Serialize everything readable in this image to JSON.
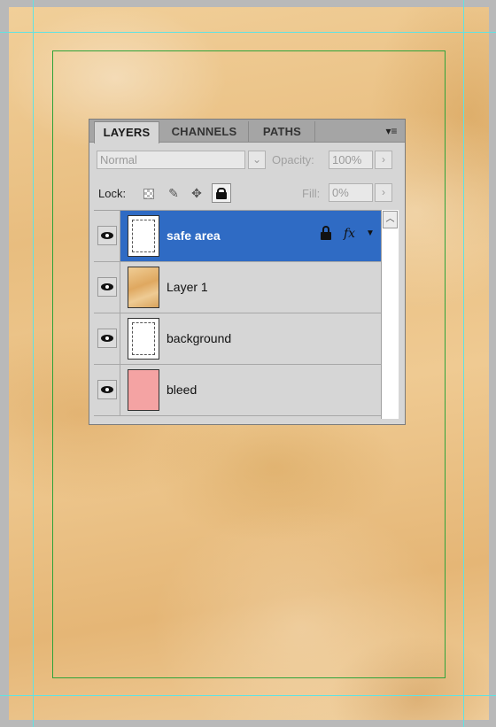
{
  "panel": {
    "tabs": [
      {
        "label": "LAYERS",
        "active": true
      },
      {
        "label": "CHANNELS",
        "active": false
      },
      {
        "label": "PATHS",
        "active": false
      }
    ],
    "menu_icon": "panel-menu-icon",
    "blend_mode": "Normal",
    "opacity_label": "Opacity:",
    "opacity_value": "100%",
    "lock_label": "Lock:",
    "fill_label": "Fill:",
    "fill_value": "0%",
    "lock_icons": [
      "lock-transparent-icon",
      "lock-brush-icon",
      "lock-move-icon",
      "lock-all-icon"
    ]
  },
  "layers": [
    {
      "name": "safe area",
      "selected": true,
      "visible": true,
      "locked": true,
      "has_fx": true,
      "thumb": "white-dashed"
    },
    {
      "name": "Layer 1",
      "selected": false,
      "visible": true,
      "locked": false,
      "has_fx": false,
      "thumb": "texture"
    },
    {
      "name": "background",
      "selected": false,
      "visible": true,
      "locked": false,
      "has_fx": false,
      "thumb": "white-dashed"
    },
    {
      "name": "bleed",
      "selected": false,
      "visible": true,
      "locked": false,
      "has_fx": false,
      "thumb": "pink"
    }
  ],
  "colors": {
    "selection": "#2f6bc4",
    "guides": "#5fe3e3",
    "safe_box": "#2ea33a",
    "bleed_thumb": "#f4a3a3",
    "paper": "#edc78f"
  },
  "glyphs": {
    "dropdown_arrow": "⌄",
    "right_arrow": "›",
    "fx": "fx",
    "fx_arrow": "▼",
    "scroll_up": "︿"
  }
}
